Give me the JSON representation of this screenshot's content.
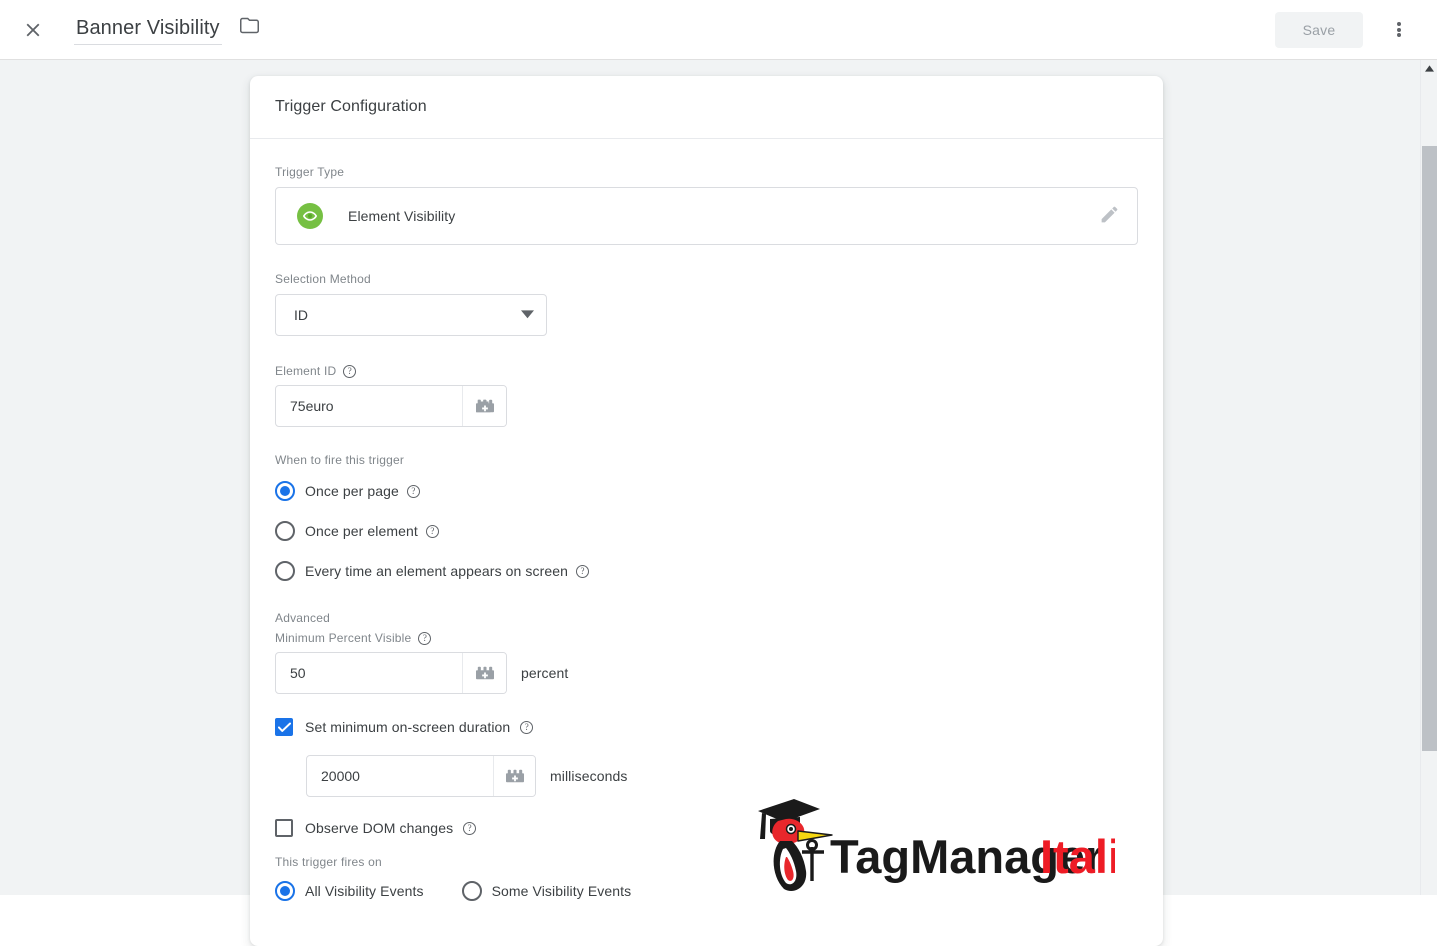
{
  "topbar": {
    "close_icon": "close-icon",
    "title": "Banner Visibility",
    "folder_icon": "folder-icon",
    "save_label": "Save",
    "overflow_icon": "more-vert-icon"
  },
  "card": {
    "header_title": "Trigger Configuration",
    "trigger_type": {
      "label": "Trigger Type",
      "icon": "element-visibility-eye-icon",
      "value": "Element Visibility",
      "edit_icon": "pencil-icon",
      "accent_color": "#76c043"
    },
    "selection_method": {
      "label": "Selection Method",
      "value": "ID",
      "dropdown_icon": "chevron-down-icon"
    },
    "element_id": {
      "label": "Element ID",
      "value": "75euro",
      "help_icon": "help-icon",
      "variable_icon": "variable-picker-icon"
    },
    "when_to_fire": {
      "label": "When to fire this trigger",
      "options": [
        {
          "label": "Once per page",
          "selected": true,
          "help_icon": "help-icon"
        },
        {
          "label": "Once per element",
          "selected": false,
          "help_icon": "help-icon"
        },
        {
          "label": "Every time an element appears on screen",
          "selected": false,
          "help_icon": "help-icon"
        }
      ]
    },
    "advanced": {
      "label": "Advanced",
      "min_percent_visible": {
        "label": "Minimum Percent Visible",
        "value": "50",
        "unit": "percent",
        "help_icon": "help-icon",
        "variable_icon": "variable-picker-icon"
      },
      "min_duration": {
        "label": "Set minimum on-screen duration",
        "checked": true,
        "value": "20000",
        "unit": "milliseconds",
        "help_icon": "help-icon",
        "variable_icon": "variable-picker-icon"
      },
      "observe_dom": {
        "label": "Observe DOM changes",
        "checked": false,
        "help_icon": "help-icon"
      }
    },
    "fires_on": {
      "label": "This trigger fires on",
      "options": [
        {
          "label": "All Visibility Events",
          "selected": true
        },
        {
          "label": "Some Visibility Events",
          "selected": false
        }
      ]
    }
  },
  "watermark": {
    "name_black": "TagManager",
    "name_red": "Italia",
    "logo_icon": "woodpecker-graduate-logo"
  },
  "colors": {
    "accent_blue": "#1a73e8",
    "trigger_green": "#76c043",
    "red": "#ee1c25",
    "page_bg": "#f1f3f4",
    "text": "#3c4043",
    "muted": "#80868b"
  },
  "scrollbar": {
    "up_arrow_icon": "scroll-up-arrow-icon",
    "thumb": "scrollbar-thumb"
  }
}
